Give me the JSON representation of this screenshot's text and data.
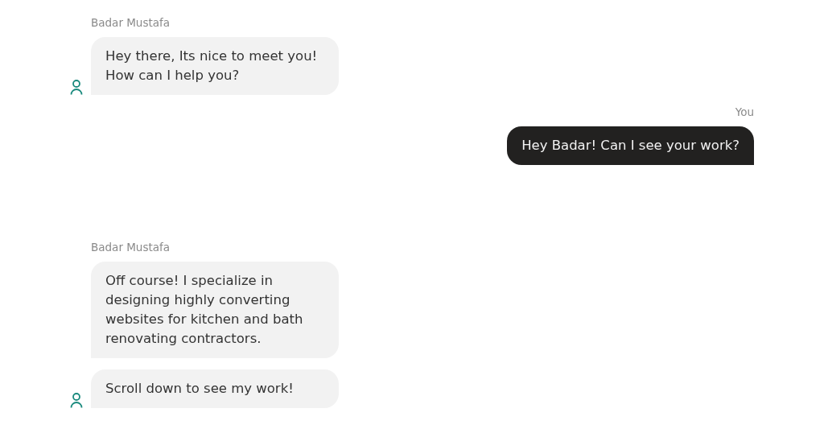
{
  "conversation": [
    {
      "kind": "bot",
      "sender": "Badar Mustafa",
      "messages": [
        "Hey there, Its nice to meet you! How can I help you?"
      ]
    },
    {
      "kind": "user",
      "sender": "You",
      "messages": [
        "Hey Badar! Can I see your work?"
      ]
    },
    {
      "kind": "bot",
      "sender": "Badar Mustafa",
      "messages": [
        "Off course! I specialize  in designing highly converting websites for kitchen and bath renovating contractors.",
        "Scroll down to see my work!"
      ]
    }
  ]
}
